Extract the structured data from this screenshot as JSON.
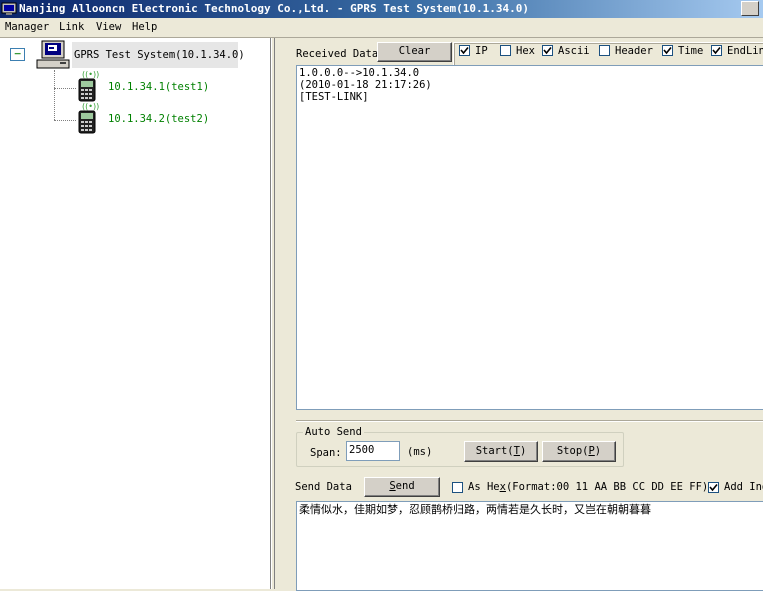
{
  "window": {
    "title": "Nanjing Allooncn Electronic Technology Co.,Ltd. - GPRS Test System(10.1.34.0)"
  },
  "menu": {
    "items": [
      "Manager",
      "Link",
      "View",
      "Help"
    ]
  },
  "tree": {
    "root_label": "GPRS Test System(10.1.34.0)",
    "expander": "−",
    "children": [
      {
        "label": "10.1.34.1(test1)"
      },
      {
        "label": "10.1.34.2(test2)"
      }
    ]
  },
  "received": {
    "label": "Received Data",
    "clear_button": "Clear",
    "options": [
      {
        "label": "IP",
        "checked": true
      },
      {
        "label": "Hex",
        "checked": false
      },
      {
        "label": "Ascii",
        "checked": true
      },
      {
        "label": "Header",
        "checked": false
      },
      {
        "label": "Time",
        "checked": true
      },
      {
        "label": "EndLin",
        "checked": true
      }
    ],
    "content": "1.0.0.0-->10.1.34.0\n(2010-01-18 21:17:26)\n[TEST-LINK]"
  },
  "auto_send": {
    "title": "Auto Send",
    "span_label": "Span:",
    "span_value": "2500",
    "unit": "(ms)",
    "start_button": {
      "text": "Start(",
      "key": "T",
      "close": ")"
    },
    "stop_button": {
      "text": "Stop(",
      "key": "P",
      "close": ")"
    }
  },
  "send": {
    "label": "Send Data",
    "send_button": {
      "key": "S",
      "rest": "end"
    },
    "as_hex": {
      "label_pre": "As He",
      "key": "x",
      "label_post": "(Format:00 11 AA BB CC DD EE FF)",
      "checked": false
    },
    "add_ind": {
      "label": "Add Ind",
      "checked": true
    },
    "content": "柔情似水，佳期如梦，忍顾鹊桥归路，两情若是久长时，又岂在朝朝暮暮"
  },
  "colors": {
    "tree_child_text": "#008000",
    "title_start": "#0a246a",
    "window_bg": "#ece9d8"
  }
}
